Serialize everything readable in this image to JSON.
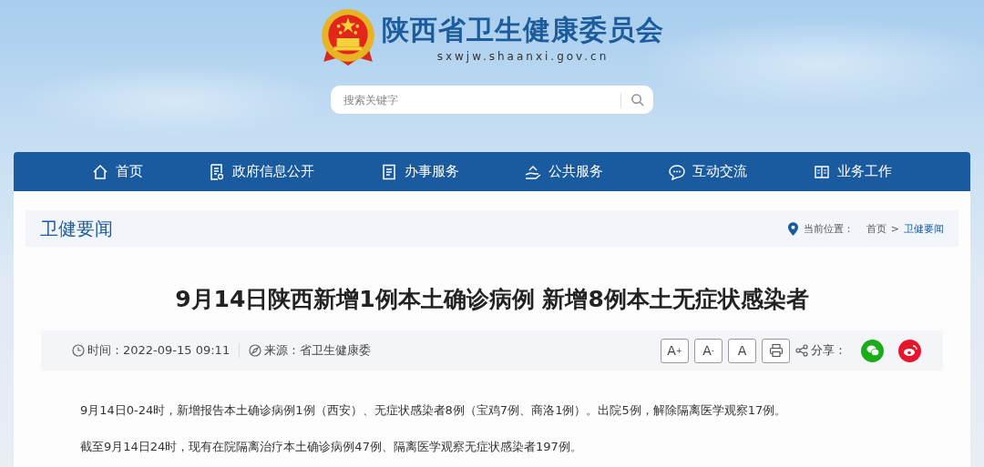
{
  "header": {
    "site_title": "陕西省卫生健康委员会",
    "domain": "sxwjw.shaanxi.gov.cn",
    "search": {
      "placeholder": "搜索关键字"
    }
  },
  "nav": [
    {
      "label": "首页",
      "selected": false
    },
    {
      "label": "政府信息公开",
      "selected": false
    },
    {
      "label": "办事服务",
      "selected": false
    },
    {
      "label": "公共服务",
      "selected": false
    },
    {
      "label": "互动交流",
      "selected": false
    },
    {
      "label": "业务工作",
      "selected": false
    }
  ],
  "section": {
    "title": "卫健要闻",
    "breadcrumb_label": "当前位置：",
    "breadcrumb": [
      "首页",
      "卫健要闻"
    ],
    "separator": ">"
  },
  "article": {
    "title": "9月14日陕西新增1例本土确诊病例 新增8例本土无症状感染者",
    "time_label": "时间：",
    "time": "2022-09-15 09:11",
    "source_label": "来源：",
    "source": "省卫生健康委",
    "tools": [
      {
        "kind": "text",
        "label": "A$^{+}$"
      },
      {
        "kind": "text",
        "label": "A$^{-}$"
      },
      {
        "kind": "text",
        "label": "A"
      },
      {
        "kind": "print"
      }
    ],
    "share_label": "分享：",
    "share": [
      {
        "kind": "wechat",
        "color": "#1aad19"
      },
      {
        "kind": "weibo",
        "color": "#e6162d"
      }
    ],
    "paragraphs": [
      "9月14日0-24时，新增报告本土确诊病例1例（西安）、无症状感染者8例（宝鸡7例、商洛1例）。出院5例，解除隔离医学观察17例。",
      "截至9月14日24时，现有在院隔离治疗本土确诊病例47例、隔离医学观察无症状感染者197例。"
    ]
  }
}
